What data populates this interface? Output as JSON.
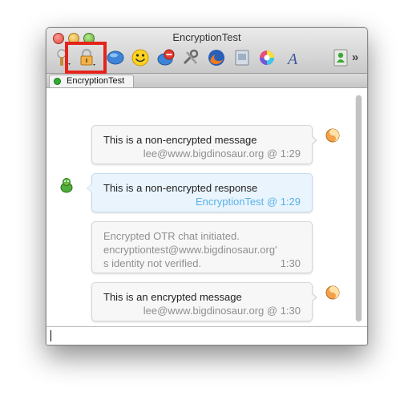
{
  "window": {
    "title": "EncryptionTest"
  },
  "toolbar": {
    "items": [
      {
        "name": "block-icon"
      },
      {
        "name": "lock-icon",
        "highlighted": true
      },
      {
        "name": "message-icon"
      },
      {
        "name": "smiley-icon"
      },
      {
        "name": "status-icon"
      },
      {
        "name": "tools-icon"
      },
      {
        "name": "browser-icon"
      },
      {
        "name": "send-file-icon"
      },
      {
        "name": "color-wheel-icon"
      },
      {
        "name": "font-icon"
      },
      {
        "name": "contact-info-icon"
      }
    ],
    "overflow": "»",
    "highlight_color": "#e5231b"
  },
  "tab": {
    "label": "EncryptionTest",
    "status_color": "#2fae2f"
  },
  "messages": [
    {
      "text": "This is a non-encrypted message",
      "meta": "lee@www.bigdinosaur.org @ 1:29",
      "side": "outgoing"
    },
    {
      "text": "This is a non-encrypted response",
      "meta": "EncryptionTest @ 1:29",
      "side": "incoming"
    },
    {
      "lines": [
        "Encrypted OTR chat initiated.",
        "encryptiontest@www.bigdinosaur.org'",
        "s identity not verified."
      ],
      "time": "1:30",
      "side": "status"
    },
    {
      "text": "This is an encrypted message",
      "meta": "lee@www.bigdinosaur.org @ 1:30",
      "side": "outgoing"
    }
  ],
  "colors": {
    "incoming_meta": "#5ab2e8",
    "incoming_bubble": "#e9f4fd",
    "outgoing_bubble": "#f7f7f7"
  }
}
